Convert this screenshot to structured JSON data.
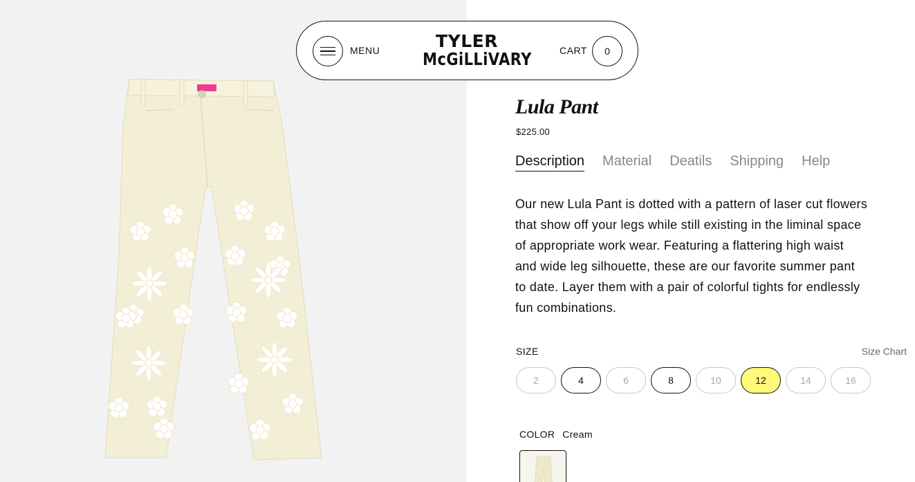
{
  "header": {
    "menu_label": "MENU",
    "logo_line1": "TYLER",
    "logo_line2": "McGiLLiVARY",
    "cart_label": "CART",
    "cart_count": "0"
  },
  "product": {
    "title": "Lula Pant",
    "price": "$225.00",
    "tabs": [
      {
        "label": "Description",
        "active": true
      },
      {
        "label": "Material",
        "active": false
      },
      {
        "label": "Deatils",
        "active": false
      },
      {
        "label": "Shipping",
        "active": false
      },
      {
        "label": "Help",
        "active": false
      }
    ],
    "description": "Our new Lula Pant is dotted with a pattern of laser cut flowers that show off your legs while still existing in the liminal space of appropriate work wear. Featuring a flattering high waist and wide leg silhouette, these are our favorite summer pant to date. Layer them with a pair of colorful tights for endlessly fun combinations.",
    "size": {
      "label": "SIZE",
      "chart_link": "Size Chart",
      "options": [
        {
          "label": "2",
          "state": "unavailable"
        },
        {
          "label": "4",
          "state": "available"
        },
        {
          "label": "6",
          "state": "unavailable"
        },
        {
          "label": "8",
          "state": "available"
        },
        {
          "label": "10",
          "state": "unavailable"
        },
        {
          "label": "12",
          "state": "selected"
        },
        {
          "label": "14",
          "state": "unavailable"
        },
        {
          "label": "16",
          "state": "unavailable"
        }
      ]
    },
    "color": {
      "label": "COLOR",
      "selected": "Cream"
    }
  },
  "colors": {
    "page_bg": "#ffffff",
    "image_panel_bg": "#f2f2f2",
    "pant_fabric": "#f3efd6",
    "selected_size_bg": "#fffa77",
    "waist_tag": "#ec3c8c"
  },
  "icons": {
    "menu": "hamburger-icon"
  }
}
